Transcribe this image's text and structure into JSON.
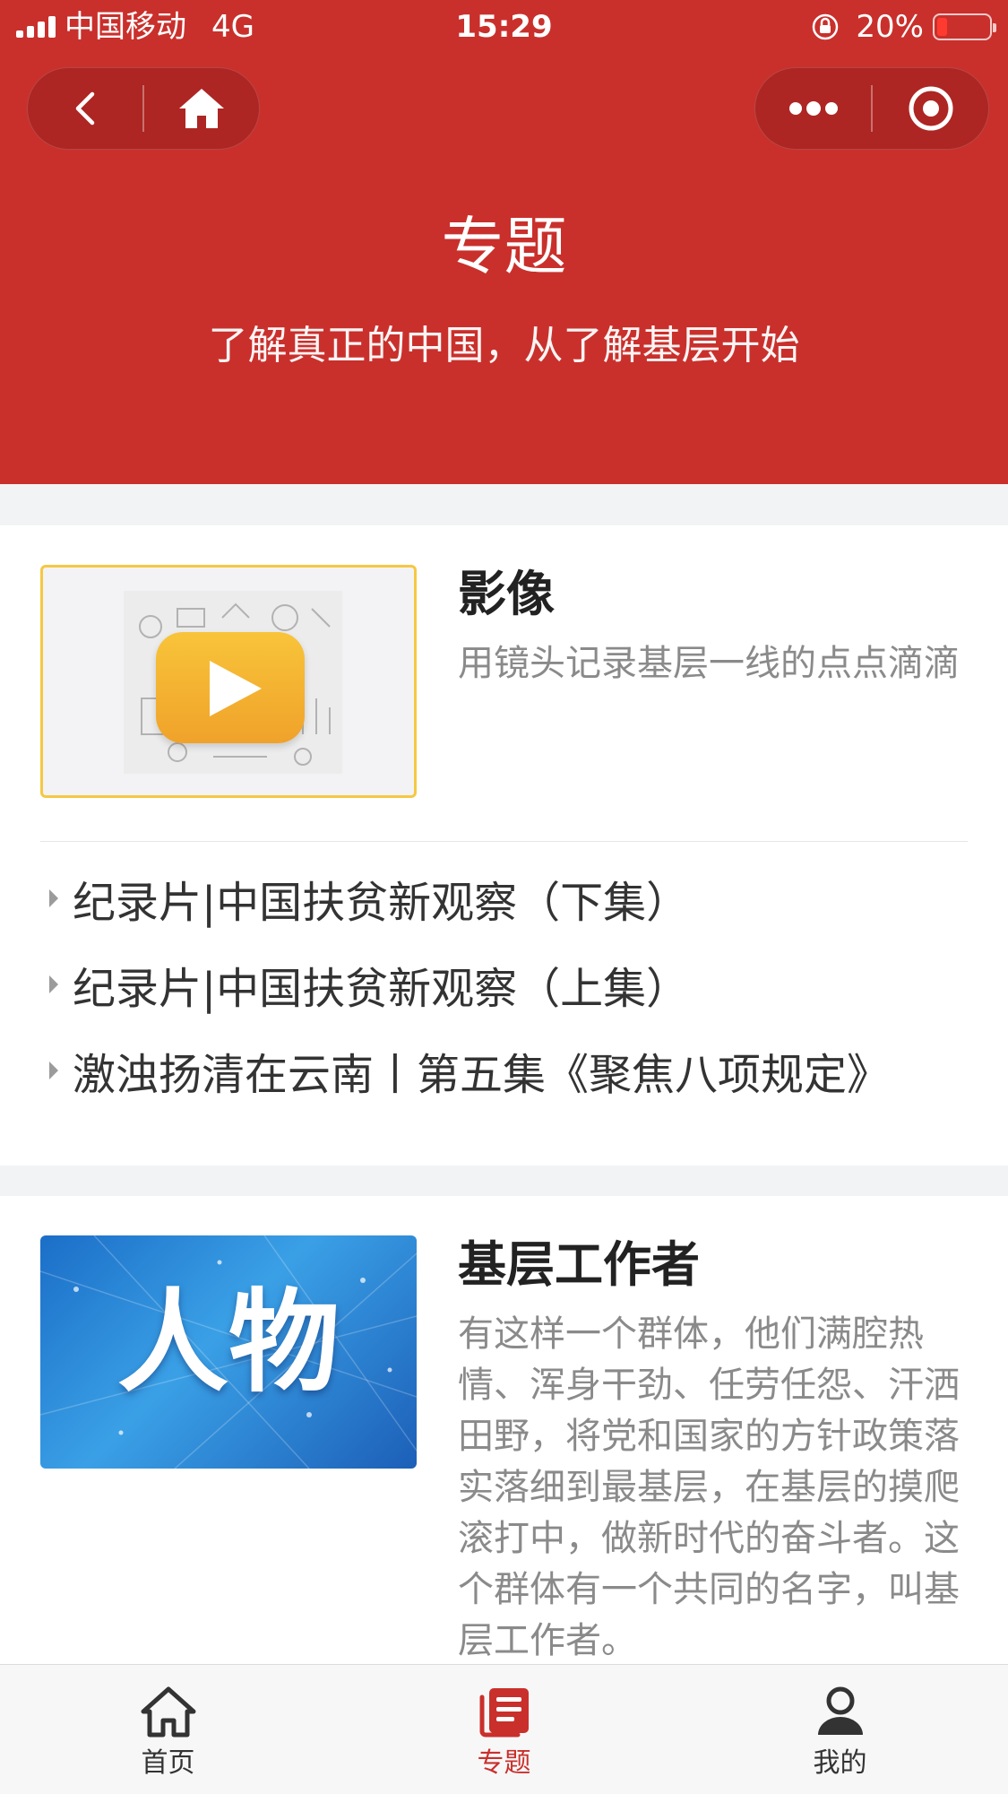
{
  "status_bar": {
    "carrier": "中国移动",
    "network": "4G",
    "time": "15:29",
    "battery": "20%",
    "battery_level": 0.2
  },
  "capsule": {
    "left_icons": [
      "back-icon",
      "home-icon"
    ],
    "right_icons": [
      "more-icon",
      "close-target-icon"
    ]
  },
  "header": {
    "title": "专题",
    "subtitle": "了解真正的中国，从了解基层开始"
  },
  "sections": [
    {
      "title": "影像",
      "description": "用镜头记录基层一线的点点滴滴",
      "thumb_icon": "video-play-icon",
      "items": [
        "纪录片|中国扶贫新观察（下集）",
        "纪录片|中国扶贫新观察（上集）",
        "激浊扬清在云南丨第五集《聚焦八项规定》"
      ]
    },
    {
      "title": "基层工作者",
      "description": "有这样一个群体，他们满腔热情、浑身干劲、任劳任怨、汗洒田野，将党和国家的方针政策落实落细到最基层，在基层的摸爬滚打中，做新时代的奋斗者。这个群体有一个共同的名字，叫基层工作者。",
      "thumb_text": "人物"
    }
  ],
  "tabbar": {
    "tabs": [
      {
        "label": "首页",
        "icon": "home-icon"
      },
      {
        "label": "专题",
        "icon": "topics-icon",
        "active": true
      },
      {
        "label": "我的",
        "icon": "user-icon"
      }
    ]
  },
  "colors": {
    "brand_red": "#c9302c",
    "play_yellow": "#f5b331",
    "text_gray": "#8a8a8a"
  }
}
